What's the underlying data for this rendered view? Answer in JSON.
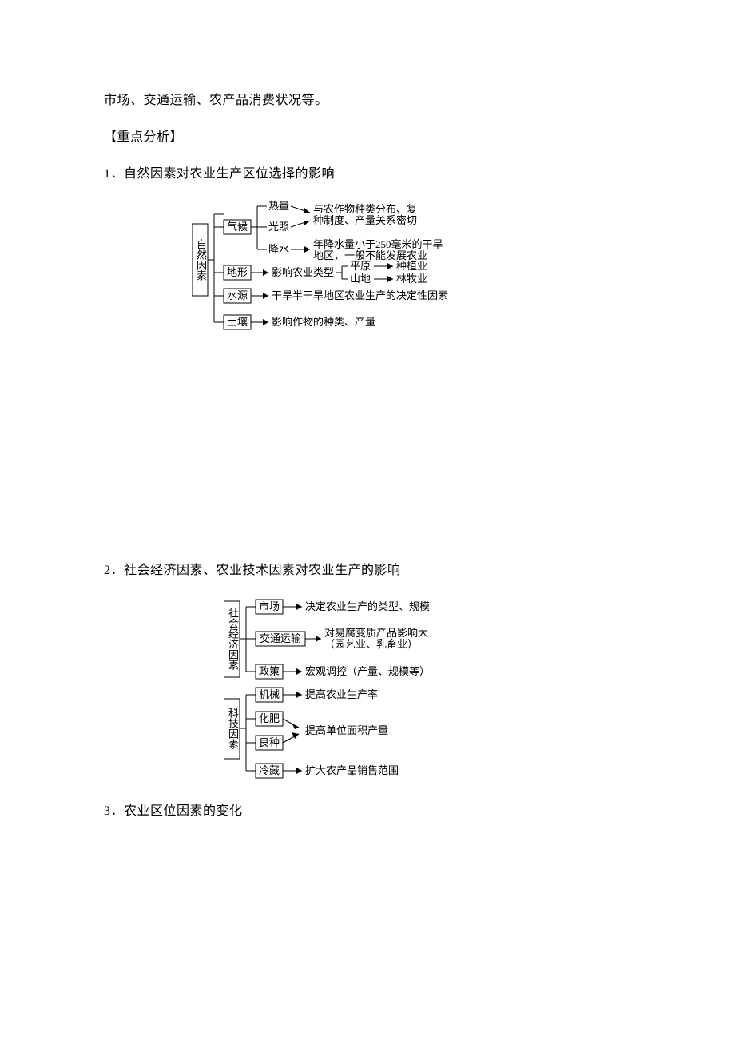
{
  "intro_line": "市场、交通运输、农产品消费状况等。",
  "section_heading": "【重点分析】",
  "point1": "1．自然因素对农业生产区位选择的影响",
  "point2": "2．社会经济因素、农业技术因素对农业生产的影响",
  "point3": "3．农业区位因素的变化",
  "diagram1": {
    "root": "自然因素",
    "branches": {
      "climate": {
        "label": "气候",
        "heat": "热量",
        "light": "光照",
        "rain": "降水",
        "desc1a": "与农作物种类分布、复",
        "desc1b": "种制度、产量关系密切",
        "desc2a": "年降水量小于250毫米的干旱",
        "desc2b": "地区，一般不能发展农业"
      },
      "terrain": {
        "label": "地形",
        "mid": "影响农业类型",
        "plain": "平原",
        "mount": "山地",
        "plain_r": "种植业",
        "mount_r": "林牧业"
      },
      "water": {
        "label": "水源",
        "desc": "干旱半干旱地区农业生产的决定性因素"
      },
      "soil": {
        "label": "土壤",
        "desc": "影响作物的种类、产量"
      }
    }
  },
  "diagram2": {
    "root1": "社会经济因素",
    "root2": "科技因素",
    "b": {
      "market": {
        "label": "市场",
        "desc": "决定农业生产的类型、规模"
      },
      "transport": {
        "label": "交通运输",
        "desc1": "对易腐变质产品影响大",
        "desc2": "（园艺业、乳畜业）"
      },
      "policy": {
        "label": "政策",
        "desc": "宏观调控（产量、规模等）"
      },
      "machine": {
        "label": "机械",
        "desc": "提高农业生产率"
      },
      "fertilizer": {
        "label": "化肥",
        "desc": "提高单位面积产量"
      },
      "seed": {
        "label": "良种"
      },
      "cold": {
        "label": "冷藏",
        "desc": "扩大农产品销售范围"
      }
    }
  }
}
